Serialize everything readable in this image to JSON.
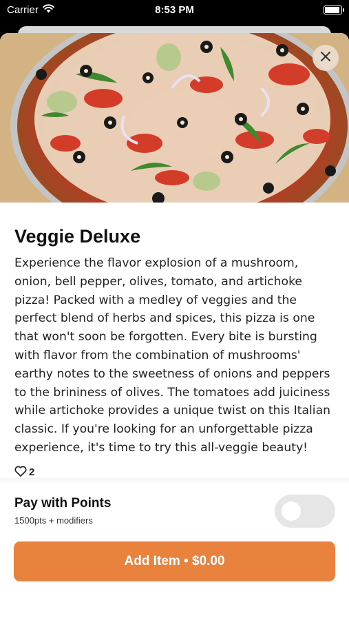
{
  "status_bar": {
    "carrier": "Carrier",
    "time": "8:53 PM",
    "battery_level": 0.95
  },
  "item": {
    "title": "Veggie Deluxe",
    "description": "Experience the flavor explosion of a mushroom, onion, bell pepper, olives, tomato, and artichoke pizza! Packed with a medley of veggies and the perfect blend of herbs and spices, this pizza is one that won't soon be forgotten. Every bite is bursting with flavor from the combination of mushrooms' earthy notes to the sweetness of onions and peppers to the brininess of olives. The tomatoes add juiciness while artichoke provides a unique twist on this Italian classic. If you're looking for an unforgettable pizza experience, it's time to try this all-veggie beauty!",
    "likes": "2",
    "image_icon": "pizza-photo"
  },
  "points": {
    "title": "Pay with Points",
    "subtitle": "1500pts + modifiers",
    "enabled": false
  },
  "add_button": {
    "label": "Add Item • $0.00"
  },
  "colors": {
    "accent": "#e8823d",
    "toggle_off": "#e6e6e6"
  },
  "icons": {
    "close": "close-icon",
    "like": "heart-outline-icon",
    "wifi": "wifi-icon"
  }
}
